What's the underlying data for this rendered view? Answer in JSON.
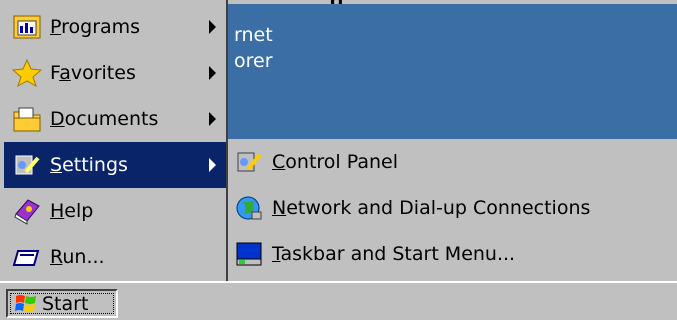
{
  "window": {
    "title": "g"
  },
  "background": {
    "line1": "rnet",
    "line2": "orer"
  },
  "start_menu": {
    "items": [
      {
        "label": "Programs",
        "mnemonic": "P",
        "icon": "programs-icon",
        "has_submenu": true
      },
      {
        "label": "Favorites",
        "mnemonic": "a",
        "icon": "favorites-star-icon",
        "has_submenu": true
      },
      {
        "label": "Documents",
        "mnemonic": "D",
        "icon": "documents-folder-icon",
        "has_submenu": true
      },
      {
        "label": "Settings",
        "mnemonic": "S",
        "icon": "settings-icon",
        "has_submenu": true,
        "selected": true
      },
      {
        "label": "Help",
        "mnemonic": "H",
        "icon": "help-book-icon",
        "has_submenu": false
      },
      {
        "label": "Run...",
        "mnemonic": "R",
        "icon": "run-icon",
        "has_submenu": false
      }
    ]
  },
  "settings_submenu": {
    "items": [
      {
        "label": "Control Panel",
        "mnemonic": "C",
        "icon": "control-panel-icon"
      },
      {
        "label": "Network and Dial-up Connections",
        "mnemonic": "N",
        "icon": "network-globe-icon"
      },
      {
        "label": "Taskbar and Start Menu...",
        "mnemonic": "T",
        "icon": "taskbar-icon"
      }
    ]
  },
  "taskbar": {
    "start_label": "Start",
    "start_icon": "windows-flag-icon"
  },
  "colors": {
    "selected_bg": "#0a246a",
    "desktop_bg": "#3a6ea5",
    "menu_bg": "#c0c0c0"
  }
}
